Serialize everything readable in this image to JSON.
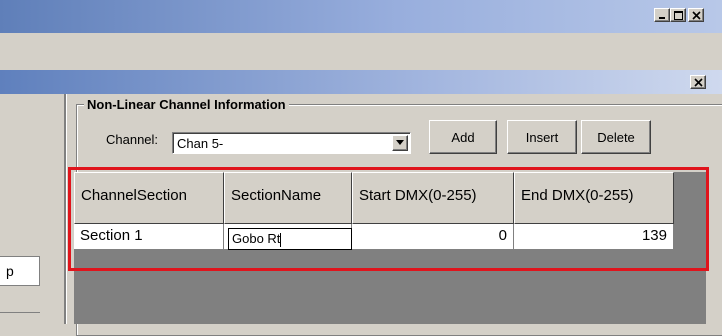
{
  "main_window": {
    "caption_buttons": [
      "minimize",
      "maximize",
      "close"
    ]
  },
  "child_window": {
    "close_label": "x"
  },
  "left_panel": {
    "stub_text": "p"
  },
  "groupbox": {
    "title": "Non-Linear Channel Information",
    "channel_label": "Channel:",
    "channel_value": "Chan 5-",
    "buttons": {
      "add": "Add",
      "insert": "Insert",
      "delete": "Delete"
    }
  },
  "grid": {
    "columns": [
      "ChannelSection",
      "SectionName",
      "Start DMX(0-255)",
      "End DMX(0-255)"
    ],
    "rows": [
      {
        "channel_section": "Section 1",
        "section_name": "Gobo Rt",
        "start_dmx": "0",
        "end_dmx": "139"
      }
    ]
  },
  "colors": {
    "highlight": "#e0141c",
    "titlebar_start": "#5f7fb9",
    "face": "#d4d0c8"
  }
}
